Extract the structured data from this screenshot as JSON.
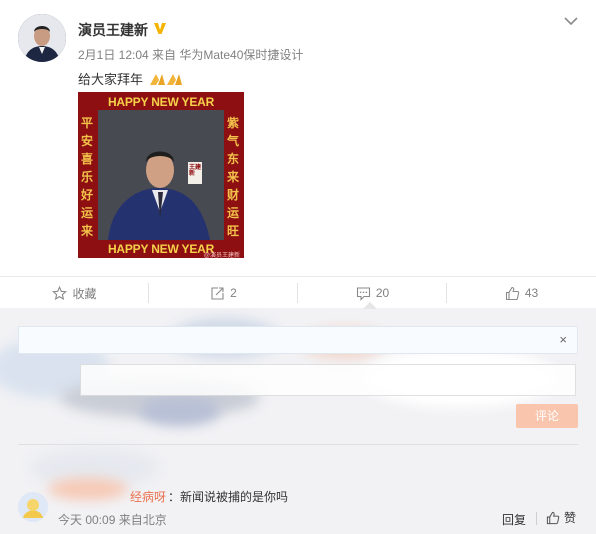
{
  "post": {
    "author": "演员王建新",
    "verified_badge": "V",
    "meta": "2月1日 12:04 来自 华为Mate40保时捷设计",
    "text": "给大家拜年",
    "text_emoji": "pray-hands-icon",
    "image": {
      "banner_top": "HAPPY NEW YEAR",
      "banner_bottom": "HAPPY NEW YEAR",
      "left_couplet": "平安喜乐好运来",
      "right_couplet": "紫气东来财运旺",
      "name_tag": "王建新",
      "watermark": "@演员王建新"
    }
  },
  "actions": {
    "favorite_label": "收藏",
    "repost_count": "2",
    "comment_count": "20",
    "like_count": "43"
  },
  "comment_box": {
    "close_symbol": "×",
    "submit_label": "评论"
  },
  "comments": [
    {
      "user_fragment": "经病呀",
      "separator": "：",
      "text": "新闻说被捕的是你吗",
      "time": "今天 00:09 来自北京",
      "reply_label": "回复",
      "like_label": "赞"
    }
  ],
  "colors": {
    "accent_orange": "#eb7350",
    "muted_text": "#808080",
    "verified": "#f5b400",
    "image_red": "#8e0f12"
  }
}
